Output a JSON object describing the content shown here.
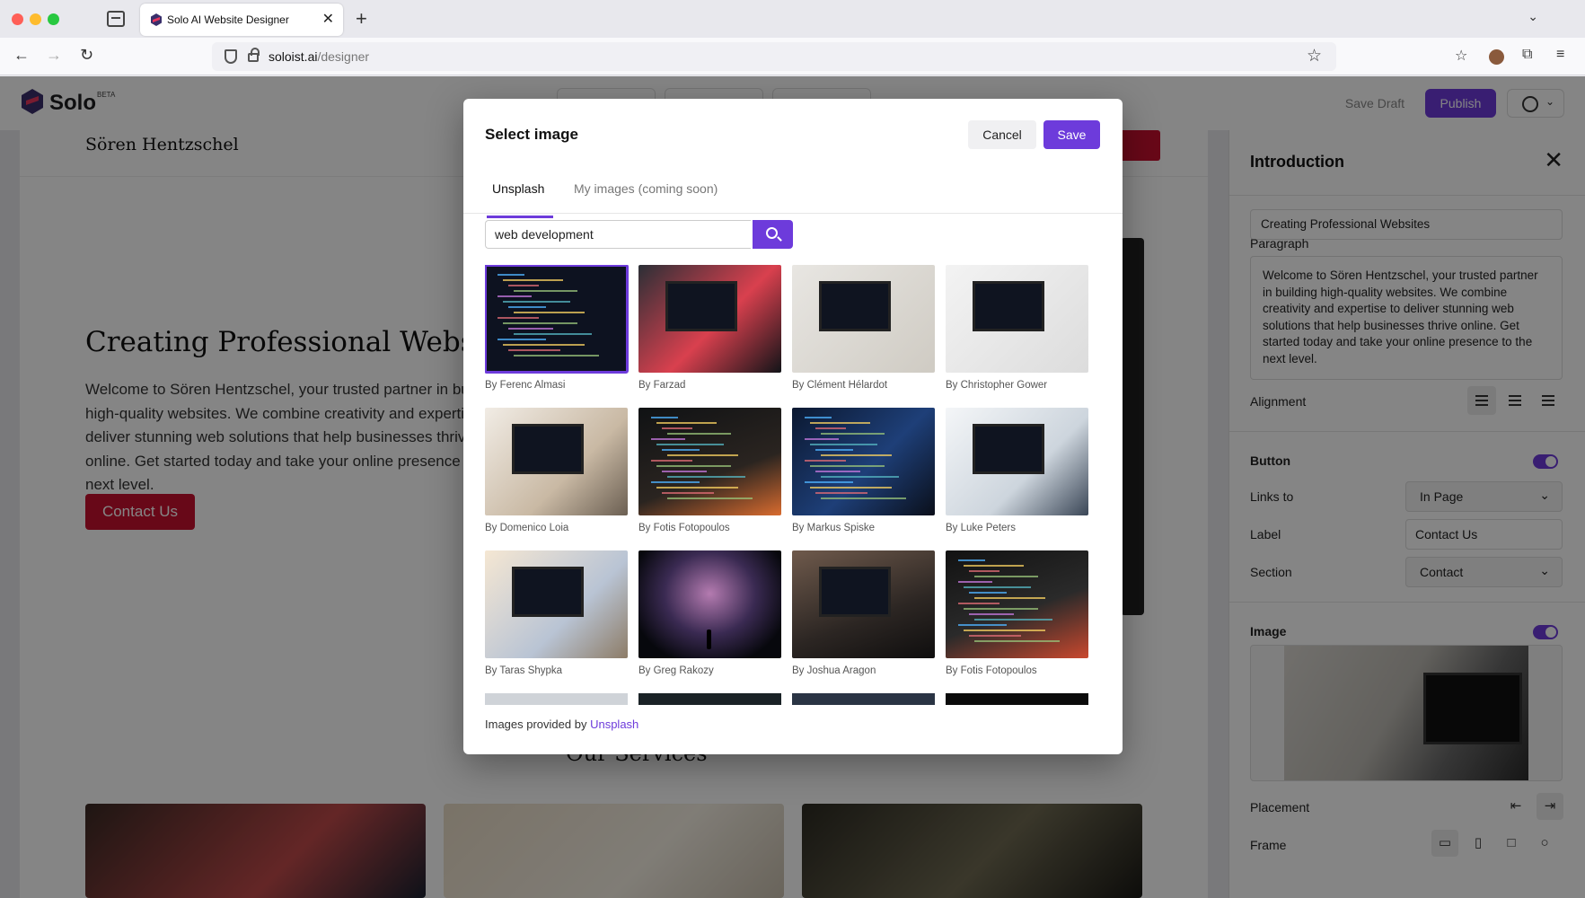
{
  "browser": {
    "tab_title": "Solo AI Website Designer",
    "url_host": "soloist.ai",
    "url_path": "/designer"
  },
  "app": {
    "brand": "Solo",
    "beta": "BETA",
    "save_draft": "Save Draft",
    "publish": "Publish",
    "accent_color": "#6d3bdb"
  },
  "site": {
    "name": "Sören Hentzschel",
    "hero_title": "Creating Professional Websites",
    "hero_paragraph": "Welcome to Sören Hentzschel, your trusted partner in building high-quality websites. We combine creativity and expertise to deliver stunning web solutions that help businesses thrive online. Get started today and take your online presence to the next level.",
    "contact_button": "Contact Us",
    "services_title": "Our Services",
    "brand_color": "#c8102e"
  },
  "modal": {
    "title": "Select image",
    "cancel": "Cancel",
    "save": "Save",
    "tabs": [
      "Unsplash",
      "My images (coming soon)"
    ],
    "search_value": "web development",
    "footer_prefix": "Images provided by",
    "footer_link": "Unsplash",
    "images": [
      {
        "author": "By Ferenc Almasi",
        "selected": true
      },
      {
        "author": "By Farzad"
      },
      {
        "author": "By Clément Hélardot"
      },
      {
        "author": "By Christopher Gower"
      },
      {
        "author": "By Domenico Loia"
      },
      {
        "author": "By Fotis Fotopoulos"
      },
      {
        "author": "By Markus Spiske"
      },
      {
        "author": "By Luke Peters"
      },
      {
        "author": "By Taras Shypka"
      },
      {
        "author": "By Greg Rakozy"
      },
      {
        "author": "By Joshua Aragon"
      },
      {
        "author": "By Fotis Fotopoulos"
      }
    ]
  },
  "panel": {
    "title": "Introduction",
    "heading_value": "Creating Professional Websites",
    "paragraph_label": "Paragraph",
    "paragraph_value": "Welcome to Sören Hentzschel, your trusted partner in building high-quality websites. We combine creativity and expertise to deliver stunning web solutions that help businesses thrive online. Get started today and take your online presence to the next level.",
    "alignment_label": "Alignment",
    "button_label": "Button",
    "links_to_label": "Links to",
    "links_to_value": "In Page",
    "label_label": "Label",
    "label_value": "Contact Us",
    "section_label": "Section",
    "section_value": "Contact",
    "image_label": "Image",
    "placement_label": "Placement",
    "frame_label": "Frame"
  }
}
